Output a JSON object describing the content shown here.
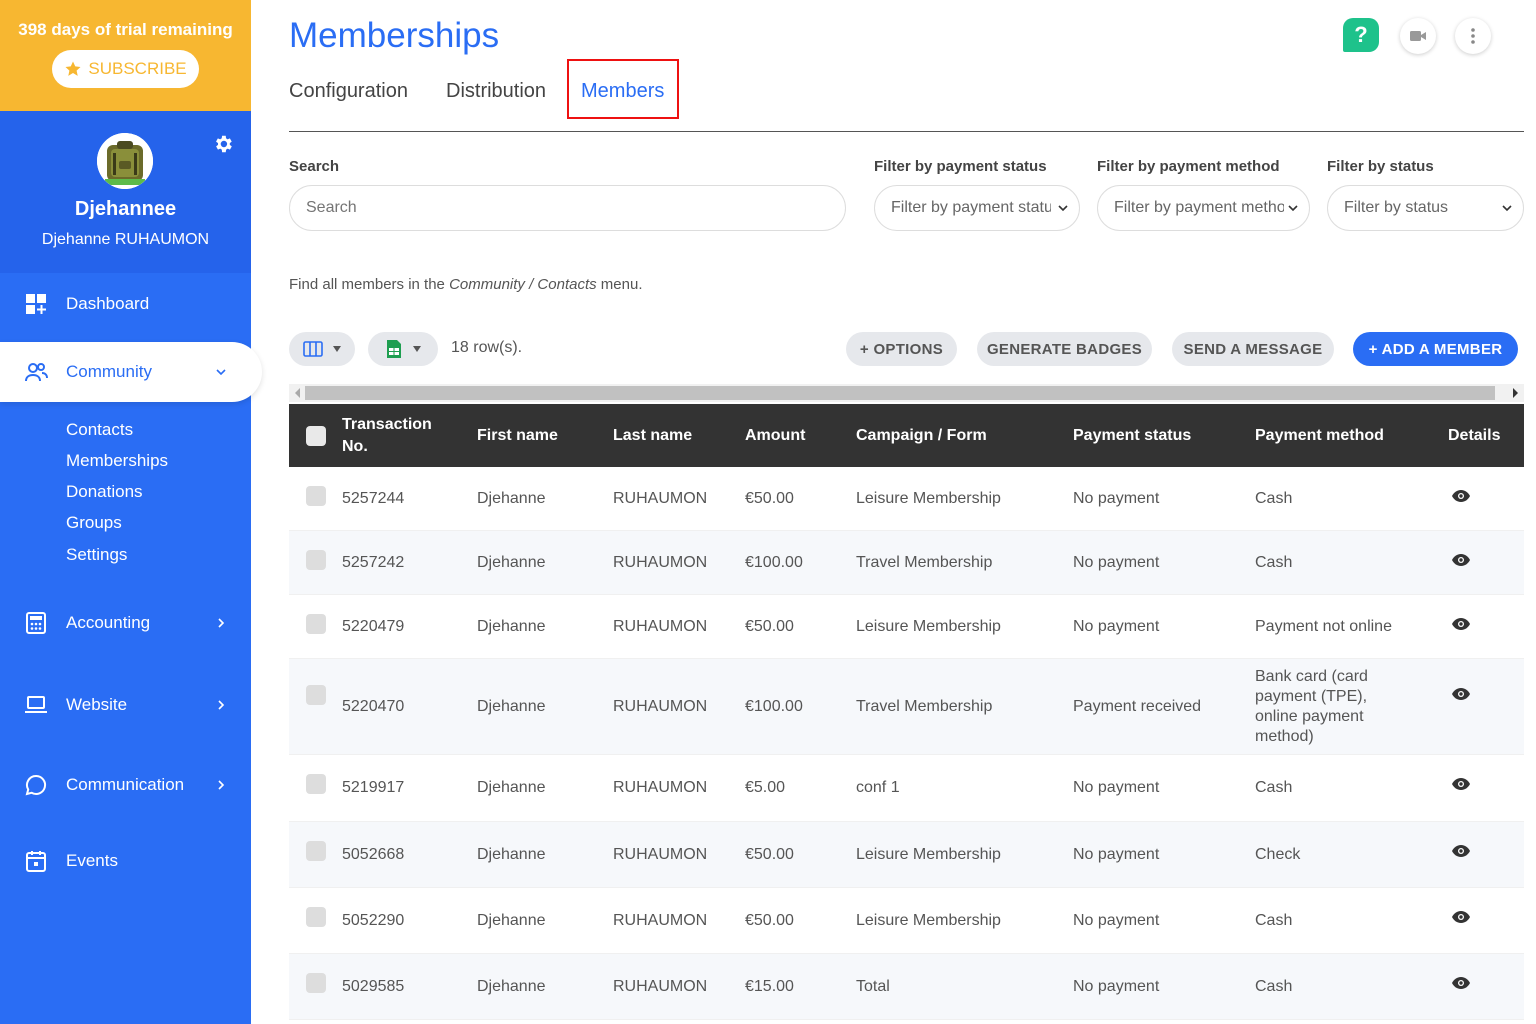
{
  "trial": {
    "text": "398 days of trial remaining",
    "subscribe_label": "SUBSCRIBE"
  },
  "profile": {
    "name": "Djehannee",
    "full_name": "Djehanne RUHAUMON"
  },
  "nav": {
    "dashboard": "Dashboard",
    "community": "Community",
    "community_sub": [
      "Contacts",
      "Memberships",
      "Donations",
      "Groups",
      "Settings"
    ],
    "accounting": "Accounting",
    "website": "Website",
    "communication": "Communication",
    "events": "Events"
  },
  "page": {
    "title": "Memberships",
    "tabs": [
      "Configuration",
      "Distribution",
      "Members"
    ],
    "active_tab": "Members"
  },
  "filters": {
    "search_label": "Search",
    "search_placeholder": "Search",
    "payment_status_label": "Filter by payment status",
    "payment_status_value": "Filter by payment status",
    "payment_method_label": "Filter by payment method",
    "payment_method_value": "Filter by payment method",
    "status_label": "Filter by status",
    "status_value": "Filter by status"
  },
  "info": {
    "prefix": "Find all members in the ",
    "path": "Community / Contacts",
    "suffix": " menu."
  },
  "toolbar": {
    "rows_count": "18 row(s).",
    "options": "+ OPTIONS",
    "generate_badges": "GENERATE BADGES",
    "send_message": "SEND A MESSAGE",
    "add_member": "+ ADD A MEMBER"
  },
  "table": {
    "headers": [
      "Transaction No.",
      "First name",
      "Last name",
      "Amount",
      "Campaign / Form",
      "Payment status",
      "Payment method",
      "Details"
    ],
    "rows": [
      [
        "5257244",
        "Djehanne",
        "RUHAUMON",
        "€50.00",
        "Leisure Membership",
        "No payment",
        "Cash"
      ],
      [
        "5257242",
        "Djehanne",
        "RUHAUMON",
        "€100.00",
        "Travel Membership",
        "No payment",
        "Cash"
      ],
      [
        "5220479",
        "Djehanne",
        "RUHAUMON",
        "€50.00",
        "Leisure Membership",
        "No payment",
        "Payment not online"
      ],
      [
        "5220470",
        "Djehanne",
        "RUHAUMON",
        "€100.00",
        "Travel Membership",
        "Payment received",
        "Bank card (card payment (TPE), online payment method)"
      ],
      [
        "5219917",
        "Djehanne",
        "RUHAUMON",
        "€5.00",
        "conf 1",
        "No payment",
        "Cash"
      ],
      [
        "5052668",
        "Djehanne",
        "RUHAUMON",
        "€50.00",
        "Leisure Membership",
        "No payment",
        "Check"
      ],
      [
        "5052290",
        "Djehanne",
        "RUHAUMON",
        "€50.00",
        "Leisure Membership",
        "No payment",
        "Cash"
      ],
      [
        "5029585",
        "Djehanne",
        "RUHAUMON",
        "€15.00",
        "Total",
        "No payment",
        "Cash"
      ]
    ]
  },
  "colors": {
    "primary": "#2a6df4",
    "trial": "#f7b731",
    "help": "#1ec28b",
    "header": "#333333"
  }
}
